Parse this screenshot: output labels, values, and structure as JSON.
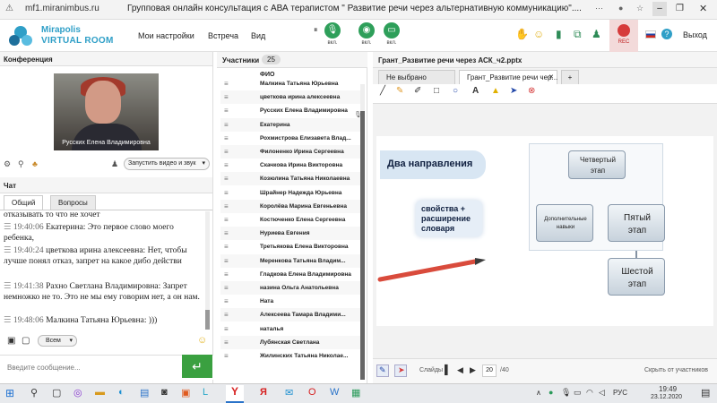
{
  "browser": {
    "url": "mf1.miranimbus.ru",
    "title": "Групповая онлайн консультация с АВА терапистом \" Развитие речи через альтернативную коммуникацию\"...."
  },
  "header": {
    "brand_line1": "Mirapolis",
    "brand_line2": "VIRTUAL ROOM",
    "menu": [
      "Мои настройки",
      "Встреча",
      "Вид"
    ],
    "mic_label": "вкл.",
    "cam_label": "вкл.",
    "screen_label": "вкл.",
    "rec_label": "REC",
    "exit_label": "Выход"
  },
  "conference": {
    "title": "Конференция",
    "video_name": "Русских Елена Владимировна",
    "start_video_label": "Запустить видео и звук"
  },
  "chat": {
    "title": "Чат",
    "tabs": [
      "Общий",
      "Вопросы"
    ],
    "messages": [
      {
        "time": "",
        "author": "",
        "text": "отказывать то что не хочет"
      },
      {
        "time": "19:40:06",
        "author": "Екатерина:",
        "text": "Это первое слово моего ребенка,"
      },
      {
        "time": "19:40:24",
        "author": "цветкова  ирина алексеевна:",
        "text": "Нет, чтобы лучше понял отказ, запрет на какое дибо действи"
      },
      {
        "time": "19:41:38",
        "author": "Рахно Светлана  Владимировна:",
        "text": "Запрет немножко не то. Это не мы ему говорим нет, а он нам."
      },
      {
        "time": "19:48:06",
        "author": "Малкина Татьяна  Юрьевна:",
        "text": ")))"
      }
    ],
    "recipient": "Всем",
    "input_placeholder": "Введите сообщение...",
    "send_icon": "↵"
  },
  "participants": {
    "title": "Участники",
    "count": "25",
    "column_header": "ФИО",
    "rows": [
      "Малкина Татьяна  Юрьевна",
      "цветкова  ирина алексеевна",
      "Русских Елена Владимировна",
      "Екатерина",
      "Рохмистрова  Елизавета Влад...",
      "Филоненко Ирина  Сергеевна",
      "Скачкова  Ирина Викторовна",
      "Козюлина  Татьяна Николаевна",
      "Шрайнер Надежда  Юрьевна",
      "Королёва Марина Евгеньевна",
      "Костюченко  Елена Сергеевна",
      "Нуриева Евгения",
      "Третьякова  Елена Викторовна",
      "Меренкова  Татьяна  Владим...",
      "Гладкова Елена Владимировна",
      "назина  Ольга  Анатольевна",
      "Ната",
      "Алексеева  Тамара Владими...",
      "наталья",
      "Лубянская Светлана",
      "Жилинских  Татьяна Николае..."
    ]
  },
  "presentation": {
    "title": "Грант_Развитие речи через АСК_ч2.pptx",
    "tabs": [
      "Не выбрано",
      "Грант_Развитие речи чер...",
      "+"
    ],
    "slide": {
      "banner": "Два направления",
      "left_box": "свойства + расширение словаря",
      "stage4": "Четвертый этап",
      "extra": "Дополнительные навыки",
      "stage5": "Пятый этап",
      "stage6": "Шестой этап"
    },
    "slides_label": "Слайды",
    "current_slide": "20",
    "total_slides": "/40",
    "hide_label": "Скрыть от участников"
  },
  "taskbar": {
    "lang": "РУС",
    "time": "19:49",
    "date": "23.12.2020"
  }
}
